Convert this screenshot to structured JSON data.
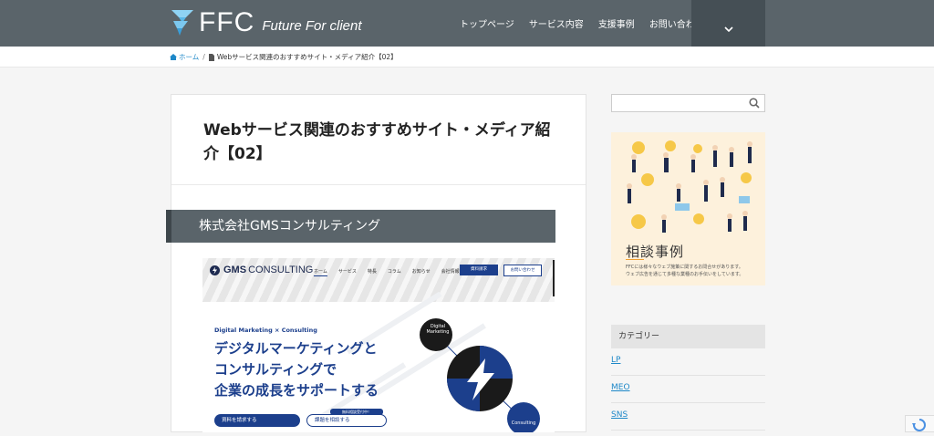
{
  "header": {
    "logo_text": "FFC",
    "logo_tagline": "Future For client",
    "nav": [
      "トップページ",
      "サービス内容",
      "支援事例",
      "お問い合わせ"
    ]
  },
  "breadcrumb": {
    "home": "ホーム",
    "current": "Webサービス関連のおすすめサイト・メディア紹介【02】"
  },
  "article": {
    "title": "Webサービス関連のおすすめサイト・メディア紹介【02】",
    "section_heading": "株式会社GMSコンサルティング"
  },
  "screenshot": {
    "logo_bold": "GMS",
    "logo_rest": "CONSULTING",
    "nav": [
      "ホーム",
      "サービス",
      "特長",
      "コラム",
      "お知らせ",
      "会社情報"
    ],
    "btn_primary": "資料請求",
    "btn_secondary": "お問い合わせ",
    "subtitle": "Digital Marketing × Consulting",
    "headline": [
      "デジタルマーケティングと",
      "コンサルティングで",
      "企業の成長をサポートする"
    ],
    "cta1": "資料を請求する",
    "cta2": "課題を相談する",
    "cta2_badge": "無料相談受付中！",
    "circle_top": [
      "Digital",
      "Marketing"
    ],
    "circle_bottom": "Consulting"
  },
  "sidebar": {
    "search_placeholder": "",
    "banner_title": "相談事例",
    "banner_text": [
      "FFCには様々なウェブ施策に関するお問合せがあります。",
      "ウェブ広告を通じて多種な業種のお手伝いをしています。"
    ],
    "category_heading": "カテゴリー",
    "categories": [
      "LP",
      "MEO",
      "SNS"
    ]
  },
  "colors": {
    "header_bg": "#5a646a",
    "accent_link": "#1e88c8",
    "gms_blue": "#1c3f8c"
  }
}
